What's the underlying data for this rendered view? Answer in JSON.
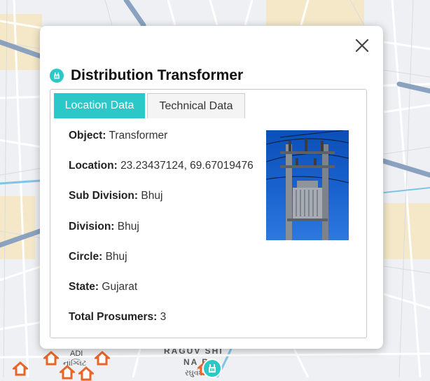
{
  "map": {
    "labels": {
      "area_1": "RAGUV  SHI",
      "area_2": "NA  R",
      "area_3": "ADI",
      "local_1": "નાંગ્લિટ",
      "local_2": "રઘુવંશી"
    },
    "colors": {
      "road": "#ffffff",
      "major_road": "#8aa2bf",
      "land": "#eef0f3",
      "builtup": "#f5e8c8",
      "water": "#7fc4e4",
      "marker_orange": "#e8652a",
      "marker_teal": "#2cc7c7"
    }
  },
  "popup": {
    "title": "Distribution Transformer",
    "title_icon": "transformer-icon",
    "close_icon": "close-icon",
    "tabs": [
      {
        "label": "Location Data",
        "active": true
      },
      {
        "label": "Technical Data",
        "active": false
      }
    ],
    "fields": [
      {
        "label": "Object:",
        "value": "Transformer"
      },
      {
        "label": "Location:",
        "value": "23.23437124, 69.67019476"
      },
      {
        "label": "Sub Division:",
        "value": "Bhuj"
      },
      {
        "label": "Division:",
        "value": "Bhuj"
      },
      {
        "label": "Circle:",
        "value": "Bhuj"
      },
      {
        "label": "State:",
        "value": "Gujarat"
      },
      {
        "label": "Total Prosumers:",
        "value": "3"
      }
    ],
    "accent_color": "#2cc7c7"
  }
}
